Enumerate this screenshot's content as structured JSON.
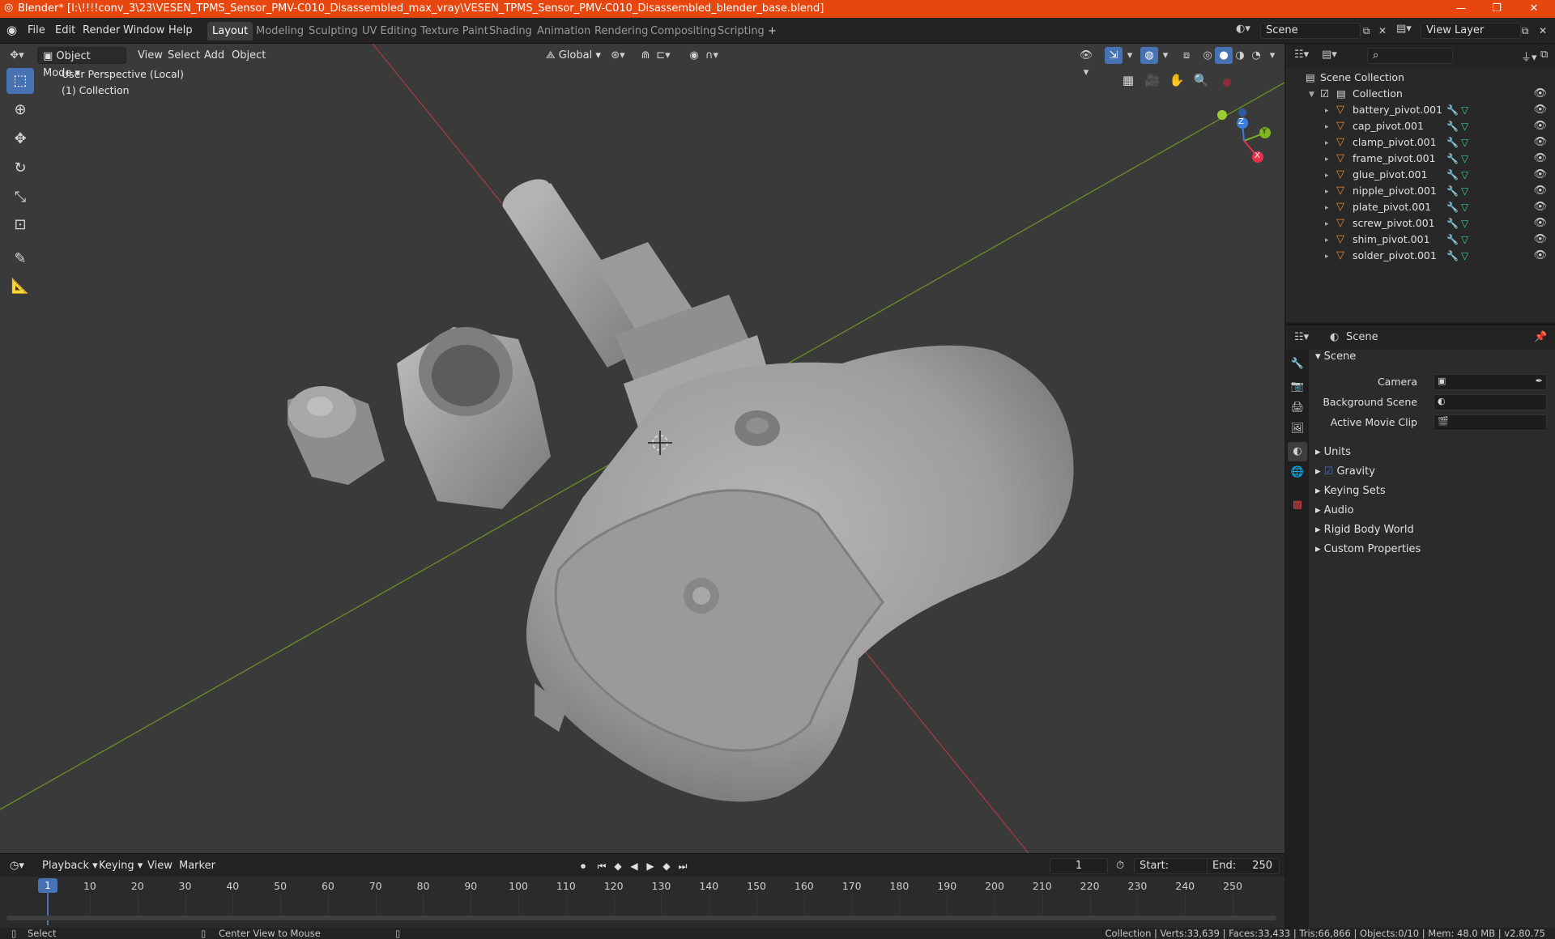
{
  "title_bar": {
    "title": "Blender* [I:\\!!!!conv_3\\23\\VESEN_TPMS_Sensor_PMV-C010_Disassembled_max_vray\\VESEN_TPMS_Sensor_PMV-C010_Disassembled_blender_base.blend]",
    "minimize": "—",
    "restore": "❐",
    "close": "✕"
  },
  "menu": {
    "file": "File",
    "edit": "Edit",
    "render": "Render",
    "window": "Window",
    "help": "Help"
  },
  "workspaces": [
    "Layout",
    "Modeling",
    "Sculpting",
    "UV Editing",
    "Texture Paint",
    "Shading",
    "Animation",
    "Rendering",
    "Compositing",
    "Scripting"
  ],
  "workspace_add": "+",
  "scene": {
    "name": "Scene",
    "view_layer": "View Layer"
  },
  "viewport": {
    "mode": "Object Mode",
    "menus": {
      "view": "View",
      "select": "Select",
      "add": "Add",
      "object": "Object"
    },
    "orientation": "Global",
    "info_line1": "User Perspective (Local)",
    "info_line2": "(1) Collection",
    "gizmo": {
      "x": "X",
      "y": "Y",
      "z": "Z"
    }
  },
  "outliner": {
    "root": "Scene Collection",
    "collection": "Collection",
    "items": [
      {
        "name": "battery_pivot.001"
      },
      {
        "name": "cap_pivot.001"
      },
      {
        "name": "clamp_pivot.001"
      },
      {
        "name": "frame_pivot.001"
      },
      {
        "name": "glue_pivot.001"
      },
      {
        "name": "nipple_pivot.001"
      },
      {
        "name": "plate_pivot.001"
      },
      {
        "name": "screw_pivot.001"
      },
      {
        "name": "shim_pivot.001"
      },
      {
        "name": "solder_pivot.001"
      }
    ]
  },
  "properties": {
    "header": "Scene",
    "section": "Scene",
    "camera_label": "Camera",
    "background_label": "Background Scene",
    "movie_clip_label": "Active Movie Clip",
    "panels": [
      "Units",
      "Gravity",
      "Keying Sets",
      "Audio",
      "Rigid Body World",
      "Custom Properties"
    ],
    "gravity_checked": true
  },
  "timeline": {
    "menus": {
      "playback": "Playback",
      "keying": "Keying",
      "view": "View",
      "marker": "Marker"
    },
    "current_frame": "1",
    "start_label": "Start:",
    "start": "1",
    "end_label": "End:",
    "end": "250",
    "ticks": [
      "10",
      "20",
      "30",
      "40",
      "50",
      "60",
      "70",
      "80",
      "90",
      "100",
      "110",
      "120",
      "130",
      "140",
      "150",
      "160",
      "170",
      "180",
      "190",
      "200",
      "210",
      "220",
      "230",
      "240",
      "250"
    ],
    "playhead": "1"
  },
  "status": {
    "select": "Select",
    "center": "Center View to Mouse",
    "stats": "Collection | Verts:33,639 | Faces:33,433 | Tris:66,866 | Objects:0/10 | Mem: 48.0 MB | v2.80.75"
  },
  "colors": {
    "accent": "#4772b3",
    "titlebar": "#e8460f",
    "axis_x": "#e5324a",
    "axis_y": "#7fb51f",
    "axis_z": "#3b7ee0"
  }
}
